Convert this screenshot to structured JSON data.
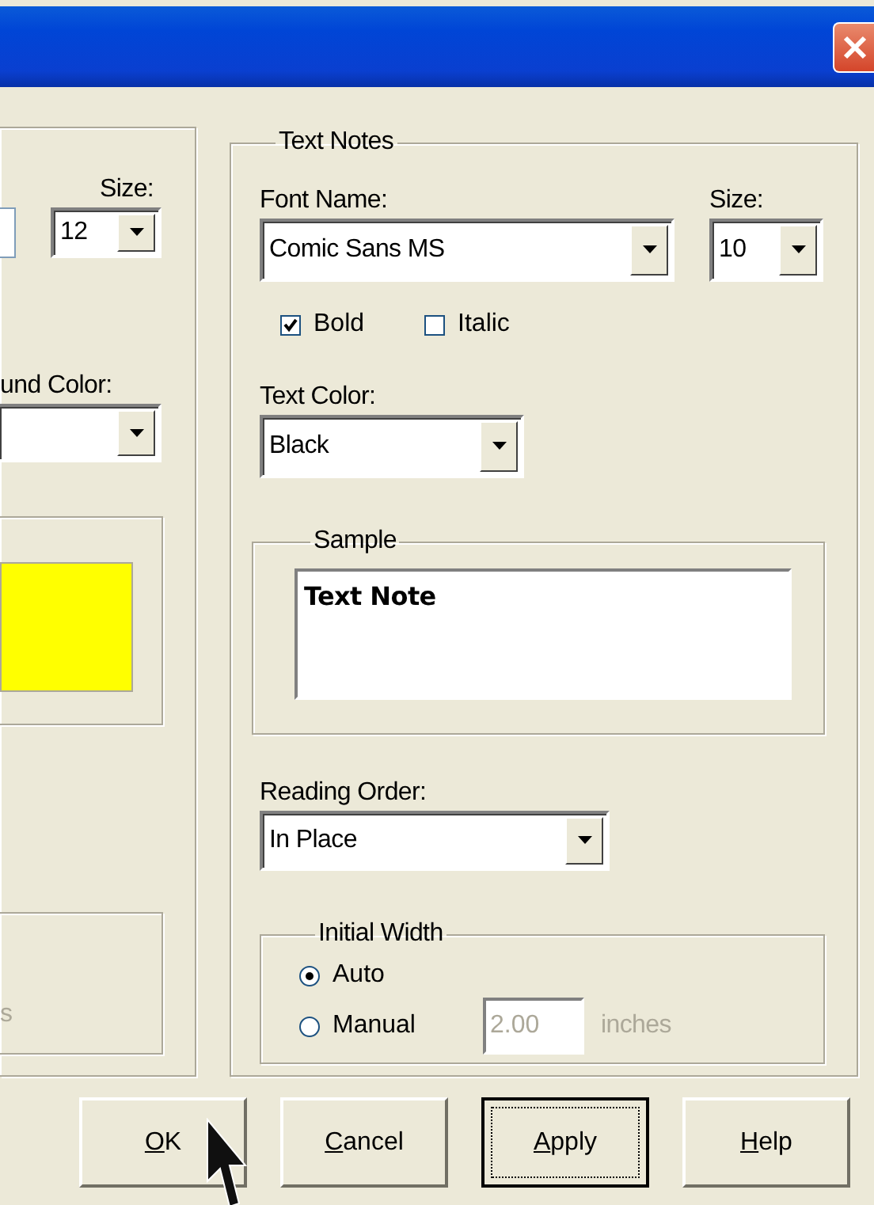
{
  "left_panel": {
    "size_label": "Size:",
    "size": "12",
    "color_label": "und Color:",
    "units_text": "s"
  },
  "text_notes": {
    "title": "Text Notes",
    "font_name_label": "Font Name:",
    "font_name": "Comic Sans MS",
    "size_label": "Size:",
    "size": "10",
    "styles": [
      {
        "label": "Bold",
        "checked": true
      },
      {
        "label": "Italic",
        "checked": false
      }
    ],
    "text_color_label": "Text Color:",
    "text_color": "Black",
    "sample_title": "Sample",
    "sample_text": "Text Note",
    "reading_order_label": "Reading Order:",
    "reading_order": "In Place",
    "initial_width": {
      "title": "Initial Width",
      "options": [
        {
          "label": "Auto",
          "selected": true
        },
        {
          "label": "Manual",
          "selected": false
        }
      ],
      "value": "2.00",
      "unit": "inches",
      "disabled": true
    }
  },
  "buttons": [
    {
      "label": "OK",
      "focused": false
    },
    {
      "label": "Cancel",
      "focused": false
    },
    {
      "label": "Apply",
      "focused": true
    },
    {
      "label": "Help",
      "focused": false
    }
  ]
}
